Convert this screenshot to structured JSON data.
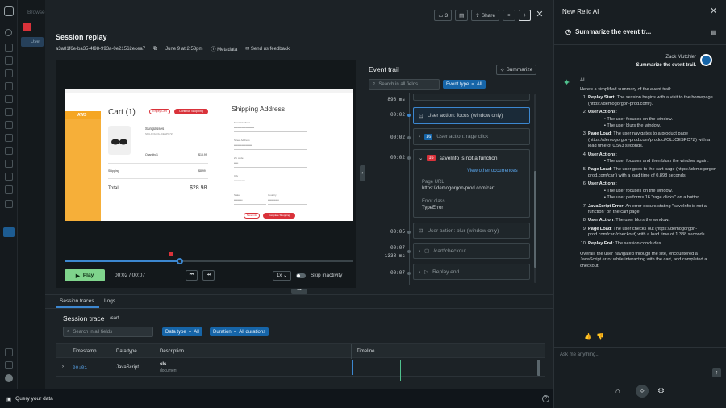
{
  "left_nav": {
    "browser_label": "Browse",
    "user_label": "User"
  },
  "toolbar": {
    "comment_count": "3",
    "share_label": "Share"
  },
  "session": {
    "title": "Session replay",
    "id": "a3a81f6e-ba35-4f98-993a-0e21562ecea7",
    "date": "June 9 at 2:53pm",
    "metadata_label": "Metadata",
    "feedback_label": "Send us feedback"
  },
  "site": {
    "aws_label": "AWS",
    "cart_title": "Cart (1)",
    "empty_cart": "Empty Cart",
    "continue_shopping": "Continue Shopping",
    "product_name": "Sunglasses",
    "product_sku": "SKU-ROL-OLJCESPC7Z",
    "quantity": "Quantity:1",
    "product_price": "$18.99",
    "shipping_label": "Shipping",
    "shipping_price": "$8.99",
    "total_label": "Total",
    "total_price": "$28.98",
    "shipping_title": "Shipping Address",
    "email_label": "E-mail Address",
    "email_value": "••••••••••••••••••••••••",
    "street_label": "Street Address",
    "street_value": "••••••••••••••••••••••",
    "zip_label": "Zip code",
    "zip_value": "•••••",
    "city_label": "City",
    "city_value": "•••••••••••••",
    "state_label": "State",
    "state_value": "••••••••••",
    "country_label": "Country",
    "country_value": "•••••••••••••",
    "save_info": "Save info",
    "place_order": "Complete Shopping"
  },
  "player": {
    "play_label": "Play",
    "time": "00:02 / 00:07",
    "speed": "1x",
    "skip_label": "Skip inactivity",
    "progress": 0.4
  },
  "event_trail": {
    "title": "Event trail",
    "summarize_label": "Summarize",
    "search_placeholder": "Search in all fields",
    "filter_label": "Event type",
    "filter_value": "All",
    "events": [
      {
        "time": "898 ms",
        "label": ""
      },
      {
        "time": "00:02",
        "label": "User action: focus (window only)"
      },
      {
        "time": "00:02",
        "label": "User action: rage click",
        "count": "16"
      },
      {
        "time": "00:02",
        "label": "saveInfo is not a function",
        "count": "16",
        "link": "View other occurrences",
        "url_label": "Page URL",
        "url_value": "https://demogorgon-prod.com/cart",
        "class_label": "Error class",
        "class_value": "TypeError"
      },
      {
        "time": "00:05",
        "label": "User action: blur (window only)"
      },
      {
        "time": "00:07",
        "label": "/cart/checkout"
      },
      {
        "time": "1338 ms",
        "label": ""
      },
      {
        "time": "00:07",
        "label": "Replay end"
      }
    ]
  },
  "bottom": {
    "tabs": [
      "Session traces",
      "Logs"
    ],
    "trace_title": "Session trace",
    "trace_path": "/cart",
    "search_placeholder": "Search in all fields",
    "filter1_label": "Data type",
    "filter1_value": "All",
    "filter2_label": "Duration",
    "filter2_value": "All durations",
    "columns": [
      "Timestamp",
      "Data type",
      "Description",
      "Timeline"
    ],
    "row": {
      "timestamp": "00:01",
      "type": "JavaScript",
      "desc": "cls",
      "desc_sub": "document"
    }
  },
  "footer": {
    "query_label": "Query your data"
  },
  "ai": {
    "panel_title": "New Relic AI",
    "conversation_title": "Summarize the event tr...",
    "user_name": "Zack Mutchler",
    "user_message": "Summarize the event trail.",
    "ai_name": "AI",
    "intro": "Here's a simplified summary of the event trail:",
    "items": [
      {
        "head": "Replay Start",
        "text": ": The session begins with a visit to the homepage (https://demogorgon-prod.com/).",
        "subs": []
      },
      {
        "head": "User Actions",
        "text": ":",
        "subs": [
          "The user focuses on the window.",
          "The user blurs the window."
        ]
      },
      {
        "head": "Page Load",
        "text": ": The user navigates to a product page (https://demogorgon-prod.com/product/OLJCESPC7Z) with a load time of 0.563 seconds.",
        "subs": []
      },
      {
        "head": "User Actions",
        "text": ":",
        "subs": [
          "The user focuses and then blurs the window again."
        ]
      },
      {
        "head": "Page Load",
        "text": ": The user goes to the cart page (https://demogorgon-prod.com/cart) with a load time of 0.898 seconds.",
        "subs": []
      },
      {
        "head": "User Actions",
        "text": ":",
        "subs": [
          "The user focuses on the window.",
          "The user performs 16 \"rage clicks\" on a button."
        ]
      },
      {
        "head": "JavaScript Error",
        "text": ": An error occurs stating \"saveInfo is not a function\" on the cart page.",
        "subs": []
      },
      {
        "head": "User Action",
        "text": ": The user blurs the window.",
        "subs": []
      },
      {
        "head": "Page Load",
        "text": ": The user checks out (https://demogorgon-prod.com/cart/checkout) with a load time of 1.338 seconds.",
        "subs": []
      },
      {
        "head": "Replay End",
        "text": ": The session concludes.",
        "subs": []
      }
    ],
    "conclusion": "Overall, the user navigated through the site, encountered a JavaScript error while interacting with the cart, and completed a checkout.",
    "input_placeholder": "Ask me anything..."
  },
  "colors": {
    "accent_blue": "#1665a8",
    "play_green": "#7fd48c",
    "error_red": "#d9323a"
  }
}
